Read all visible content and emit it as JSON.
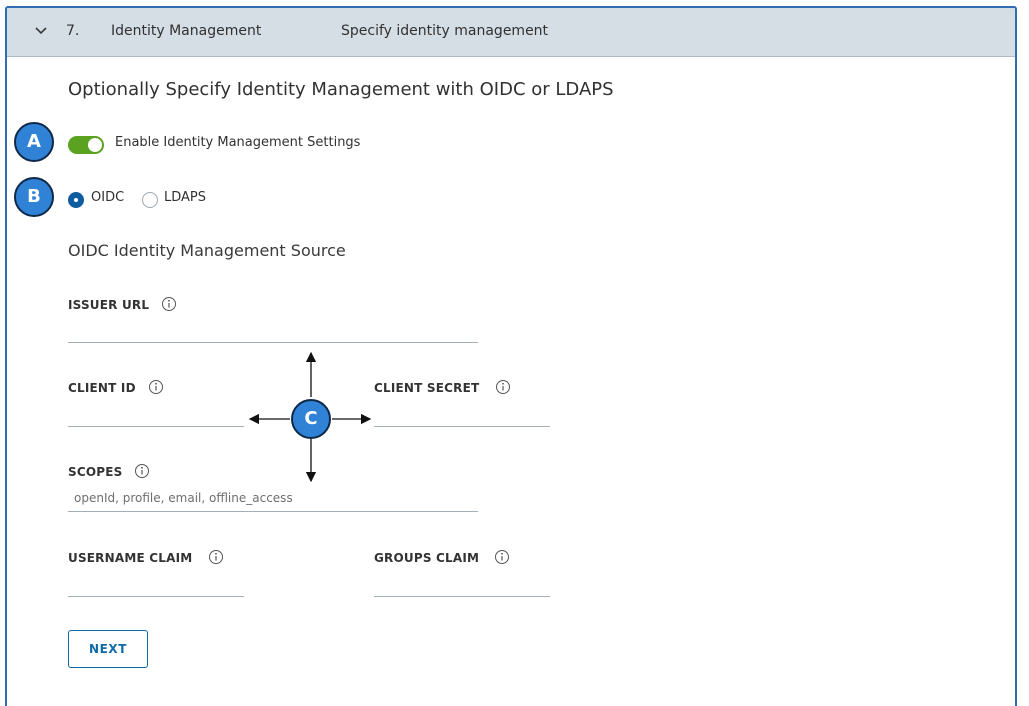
{
  "colors": {
    "header_bg": "#d5dde5",
    "panel_border": "#2f6db0",
    "toggle_on": "#5aa220",
    "radio_checked": "#0f5d9e",
    "button_primary": "#0f6aa9",
    "callout_fill": "#2f82d6"
  },
  "step": {
    "number": "7.",
    "title": "Identity Management",
    "description": "Specify identity management",
    "expand_icon": "chevron-down-icon"
  },
  "content": {
    "heading": "Optionally Specify Identity Management with OIDC or LDAPS",
    "toggle": {
      "label": "Enable Identity Management Settings",
      "enabled": true
    },
    "source_options": [
      {
        "label": "OIDC",
        "selected": true
      },
      {
        "label": "LDAPS",
        "selected": false
      }
    ],
    "subheading": "OIDC Identity Management Source",
    "fields": {
      "issuer_url": {
        "label": "ISSUER URL",
        "value": ""
      },
      "client_id": {
        "label": "CLIENT ID",
        "value": ""
      },
      "client_secret": {
        "label": "CLIENT SECRET",
        "value": ""
      },
      "scopes": {
        "label": "SCOPES",
        "placeholder": "openId, profile, email, offline_access"
      },
      "username_claim": {
        "label": "USERNAME CLAIM",
        "value": ""
      },
      "groups_claim": {
        "label": "GROUPS CLAIM",
        "value": ""
      }
    },
    "info_icon": "info-icon",
    "next_button": "NEXT"
  },
  "callouts": {
    "a": "A",
    "b": "B",
    "c": "C"
  }
}
